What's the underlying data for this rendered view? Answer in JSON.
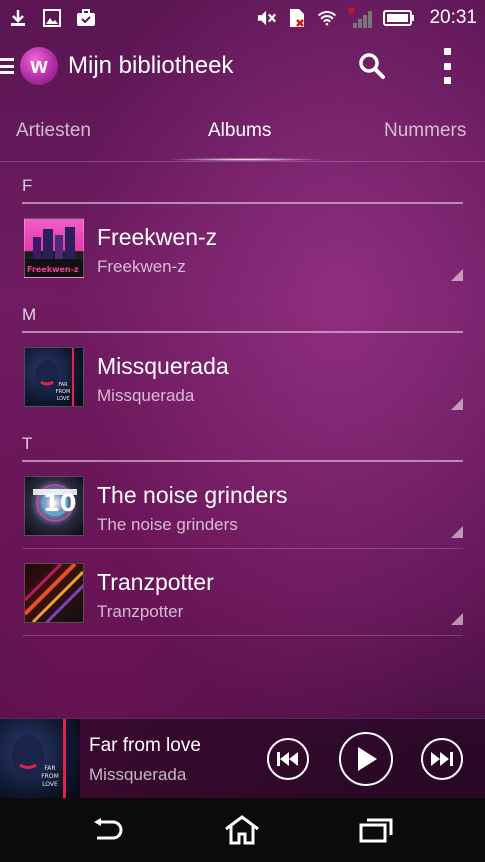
{
  "status_bar": {
    "time": "20:31",
    "icons": [
      "download-icon",
      "image-icon",
      "briefcase-check-icon",
      "mute-icon",
      "sim-no-signal-icon",
      "wifi-icon",
      "signal-bars-icon",
      "battery-icon"
    ]
  },
  "header": {
    "title": "Mijn bibliotheek",
    "logo_letter": "w"
  },
  "tabs": [
    {
      "label": "Artiesten",
      "active": false
    },
    {
      "label": "Albums",
      "active": true
    },
    {
      "label": "Nummers",
      "active": false
    }
  ],
  "sections": [
    {
      "letter": "F",
      "albums": [
        {
          "title": "Freekwen-z",
          "artist": "Freekwen-z",
          "art_label": "Freekwen-z"
        }
      ]
    },
    {
      "letter": "M",
      "albums": [
        {
          "title": "Missquerada",
          "artist": "Missquerada",
          "art_label": "FAR FROM LOVE"
        }
      ]
    },
    {
      "letter": "T",
      "albums": [
        {
          "title": "The noise grinders",
          "artist": "The noise grinders",
          "art_label": "10"
        },
        {
          "title": "Tranzpotter",
          "artist": "Tranzpotter"
        }
      ]
    }
  ],
  "now_playing": {
    "title": "Far from love",
    "artist": "Missquerada",
    "art_label": "FAR FROM LOVE"
  },
  "colors": {
    "accent": "#b22ca7",
    "background": "#6e1d63"
  }
}
